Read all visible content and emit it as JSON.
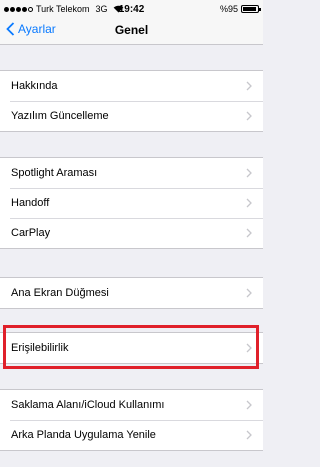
{
  "status_bar": {
    "carrier": "Turk Telekom",
    "network": "3G",
    "time": "19:42",
    "battery_text": "%95",
    "battery_level": 0.95,
    "signal_strength": 4,
    "signal_max": 5
  },
  "nav": {
    "back_label": "Ayarlar",
    "title": "Genel"
  },
  "groups": [
    {
      "rows": [
        {
          "label": "Hakkında"
        },
        {
          "label": "Yazılım Güncelleme"
        }
      ]
    },
    {
      "rows": [
        {
          "label": "Spotlight Araması"
        },
        {
          "label": "Handoff"
        },
        {
          "label": "CarPlay"
        }
      ]
    },
    {
      "rows": [
        {
          "label": "Ana Ekran Düğmesi"
        }
      ]
    },
    {
      "rows": [
        {
          "label": "Erişilebilirlik"
        }
      ]
    },
    {
      "rows": [
        {
          "label": "Saklama Alanı/iCloud Kullanımı"
        },
        {
          "label": "Arka Planda Uygulama Yenile"
        }
      ]
    }
  ],
  "colors": {
    "accent": "#0a7aff",
    "highlight": "#e0202a",
    "background": "#efeff4"
  }
}
